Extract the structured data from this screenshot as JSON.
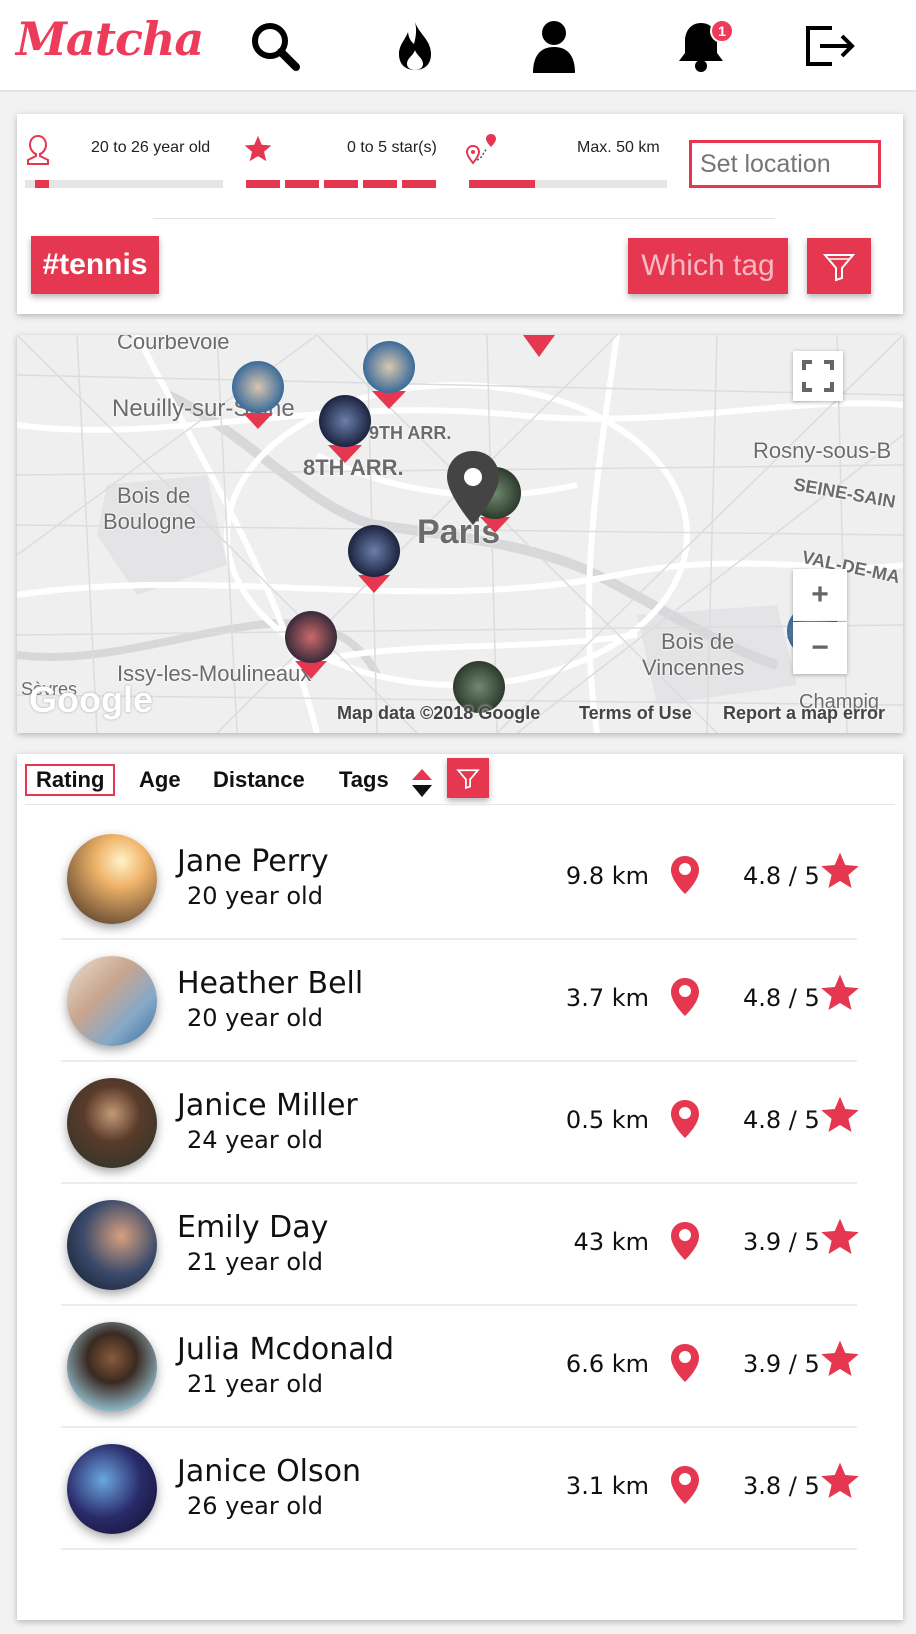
{
  "app": {
    "logo": "Matcha"
  },
  "nav": {
    "notification_count": "1",
    "icons": [
      "search-icon",
      "fire-icon",
      "profile-icon",
      "bell-icon",
      "logout-icon"
    ]
  },
  "filters": {
    "age_label": "20 to 26 year old",
    "age_range": [
      20,
      26
    ],
    "rating_label": "0 to 5 star(s)",
    "rating_range": [
      0,
      5
    ],
    "distance_label": "Max. 50 km",
    "distance_max_km": 50,
    "location_placeholder": "Set location",
    "active_tag": "#tennis",
    "which_tag_label": "Which tag"
  },
  "map": {
    "labels": {
      "courbevoie": "Courbevoie",
      "neuilly": "Neuilly-sur-Seine",
      "arr9": "9TH ARR.",
      "arr8": "8TH ARR.",
      "bois_boulogne_1": "Bois de",
      "bois_boulogne_2": "Boulogne",
      "paris": "Paris",
      "rosny": "Rosny-sous-B",
      "seine_saint": "SEINE-SAIN",
      "val_de_ma": "VAL-DE-MA",
      "bois_vincennes_1": "Bois de",
      "bois_vincennes_2": "Vincennes",
      "issy": "Issy-les-Moulineaux",
      "sevres": "Sèvres",
      "champig": "Champig"
    },
    "google_logo": "Google",
    "footer": {
      "map_data": "Map data ©2018 Google",
      "terms": "Terms of Use",
      "report": "Report a map error"
    }
  },
  "sort": {
    "rating": "Rating",
    "age": "Age",
    "distance": "Distance",
    "tags": "Tags"
  },
  "users": [
    {
      "name": "Jane Perry",
      "age": "20 year old",
      "distance": "9.8 km",
      "rating": "4.8 / 5"
    },
    {
      "name": "Heather Bell",
      "age": "20 year old",
      "distance": "3.7 km",
      "rating": "4.8 / 5"
    },
    {
      "name": "Janice Miller",
      "age": "24 year old",
      "distance": "0.5 km",
      "rating": "4.8 / 5"
    },
    {
      "name": "Emily Day",
      "age": "21 year old",
      "distance": "43 km",
      "rating": "3.9 / 5"
    },
    {
      "name": "Julia Mcdonald",
      "age": "21 year old",
      "distance": "6.6 km",
      "rating": "3.9 / 5"
    },
    {
      "name": "Janice Olson",
      "age": "26 year old",
      "distance": "3.1 km",
      "rating": "3.8 / 5"
    }
  ],
  "colors": {
    "accent": "#e5374f",
    "logo": "#ef3b5a",
    "track": "#e6e6e6"
  }
}
